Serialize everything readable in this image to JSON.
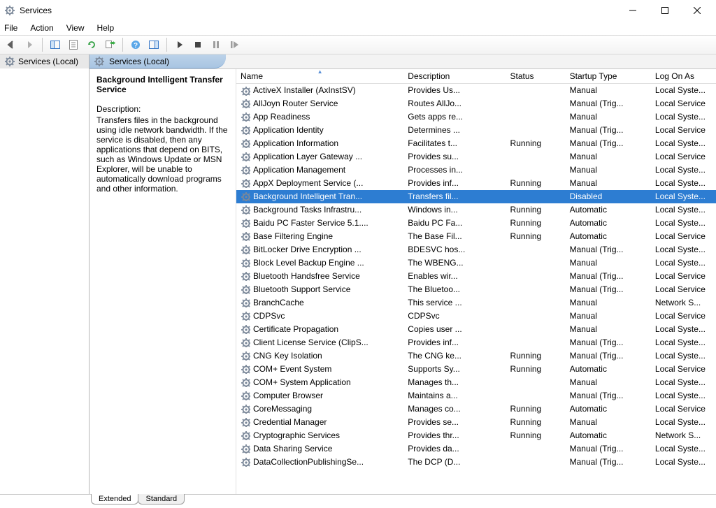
{
  "window": {
    "title": "Services"
  },
  "menu": {
    "file": "File",
    "action": "Action",
    "view": "View",
    "help": "Help"
  },
  "navtree": {
    "root": "Services (Local)"
  },
  "right_header": "Services (Local)",
  "detail": {
    "title": "Background Intelligent Transfer Service",
    "desc_label": "Description:",
    "desc": "Transfers files in the background using idle network bandwidth. If the service is disabled, then any applications that depend on BITS, such as Windows Update or MSN Explorer, will be unable to automatically download programs and other information."
  },
  "columns": {
    "name": "Name",
    "desc": "Description",
    "status": "Status",
    "startup": "Startup Type",
    "logon": "Log On As"
  },
  "tabs": {
    "extended": "Extended",
    "standard": "Standard"
  },
  "services": [
    {
      "n": "ActiveX Installer (AxInstSV)",
      "d": "Provides Us...",
      "s": "",
      "st": "Manual",
      "l": "Local Syste..."
    },
    {
      "n": "AllJoyn Router Service",
      "d": "Routes AllJo...",
      "s": "",
      "st": "Manual (Trig...",
      "l": "Local Service"
    },
    {
      "n": "App Readiness",
      "d": "Gets apps re...",
      "s": "",
      "st": "Manual",
      "l": "Local Syste..."
    },
    {
      "n": "Application Identity",
      "d": "Determines ...",
      "s": "",
      "st": "Manual (Trig...",
      "l": "Local Service"
    },
    {
      "n": "Application Information",
      "d": "Facilitates t...",
      "s": "Running",
      "st": "Manual (Trig...",
      "l": "Local Syste..."
    },
    {
      "n": "Application Layer Gateway ...",
      "d": "Provides su...",
      "s": "",
      "st": "Manual",
      "l": "Local Service"
    },
    {
      "n": "Application Management",
      "d": "Processes in...",
      "s": "",
      "st": "Manual",
      "l": "Local Syste..."
    },
    {
      "n": "AppX Deployment Service (...",
      "d": "Provides inf...",
      "s": "Running",
      "st": "Manual",
      "l": "Local Syste..."
    },
    {
      "n": "Background Intelligent Tran...",
      "d": "Transfers fil...",
      "s": "",
      "st": "Disabled",
      "l": "Local Syste...",
      "sel": true
    },
    {
      "n": "Background Tasks Infrastru...",
      "d": "Windows in...",
      "s": "Running",
      "st": "Automatic",
      "l": "Local Syste..."
    },
    {
      "n": "Baidu PC Faster Service 5.1....",
      "d": "Baidu PC Fa...",
      "s": "Running",
      "st": "Automatic",
      "l": "Local Syste..."
    },
    {
      "n": "Base Filtering Engine",
      "d": "The Base Fil...",
      "s": "Running",
      "st": "Automatic",
      "l": "Local Service"
    },
    {
      "n": "BitLocker Drive Encryption ...",
      "d": "BDESVC hos...",
      "s": "",
      "st": "Manual (Trig...",
      "l": "Local Syste..."
    },
    {
      "n": "Block Level Backup Engine ...",
      "d": "The WBENG...",
      "s": "",
      "st": "Manual",
      "l": "Local Syste..."
    },
    {
      "n": "Bluetooth Handsfree Service",
      "d": "Enables wir...",
      "s": "",
      "st": "Manual (Trig...",
      "l": "Local Service"
    },
    {
      "n": "Bluetooth Support Service",
      "d": "The Bluetoo...",
      "s": "",
      "st": "Manual (Trig...",
      "l": "Local Service"
    },
    {
      "n": "BranchCache",
      "d": "This service ...",
      "s": "",
      "st": "Manual",
      "l": "Network S..."
    },
    {
      "n": "CDPSvc",
      "d": "CDPSvc",
      "s": "",
      "st": "Manual",
      "l": "Local Service"
    },
    {
      "n": "Certificate Propagation",
      "d": "Copies user ...",
      "s": "",
      "st": "Manual",
      "l": "Local Syste..."
    },
    {
      "n": "Client License Service (ClipS...",
      "d": "Provides inf...",
      "s": "",
      "st": "Manual (Trig...",
      "l": "Local Syste..."
    },
    {
      "n": "CNG Key Isolation",
      "d": "The CNG ke...",
      "s": "Running",
      "st": "Manual (Trig...",
      "l": "Local Syste..."
    },
    {
      "n": "COM+ Event System",
      "d": "Supports Sy...",
      "s": "Running",
      "st": "Automatic",
      "l": "Local Service"
    },
    {
      "n": "COM+ System Application",
      "d": "Manages th...",
      "s": "",
      "st": "Manual",
      "l": "Local Syste..."
    },
    {
      "n": "Computer Browser",
      "d": "Maintains a...",
      "s": "",
      "st": "Manual (Trig...",
      "l": "Local Syste..."
    },
    {
      "n": "CoreMessaging",
      "d": "Manages co...",
      "s": "Running",
      "st": "Automatic",
      "l": "Local Service"
    },
    {
      "n": "Credential Manager",
      "d": "Provides se...",
      "s": "Running",
      "st": "Manual",
      "l": "Local Syste..."
    },
    {
      "n": "Cryptographic Services",
      "d": "Provides thr...",
      "s": "Running",
      "st": "Automatic",
      "l": "Network S..."
    },
    {
      "n": "Data Sharing Service",
      "d": "Provides da...",
      "s": "",
      "st": "Manual (Trig...",
      "l": "Local Syste..."
    },
    {
      "n": "DataCollectionPublishingSe...",
      "d": "The DCP (D...",
      "s": "",
      "st": "Manual (Trig...",
      "l": "Local Syste..."
    }
  ]
}
